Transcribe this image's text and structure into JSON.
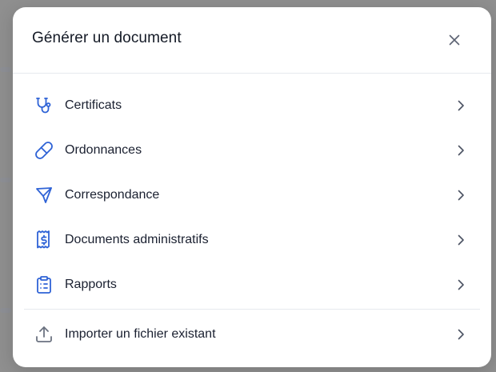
{
  "dialog": {
    "title": "Générer un document"
  },
  "menu": {
    "items": [
      {
        "label": "Certificats",
        "icon": "stethoscope-icon"
      },
      {
        "label": "Ordonnances",
        "icon": "pill-icon"
      },
      {
        "label": "Correspondance",
        "icon": "send-icon"
      },
      {
        "label": "Documents administratifs",
        "icon": "receipt-dollar-icon"
      },
      {
        "label": "Rapports",
        "icon": "clipboard-list-icon"
      }
    ],
    "import": {
      "label": "Importer un fichier existant",
      "icon": "upload-icon"
    }
  },
  "colors": {
    "accent": "#2f63d6",
    "muted_icon": "#6b7280",
    "text": "#1a2030",
    "backdrop": "#8f8f8f"
  }
}
